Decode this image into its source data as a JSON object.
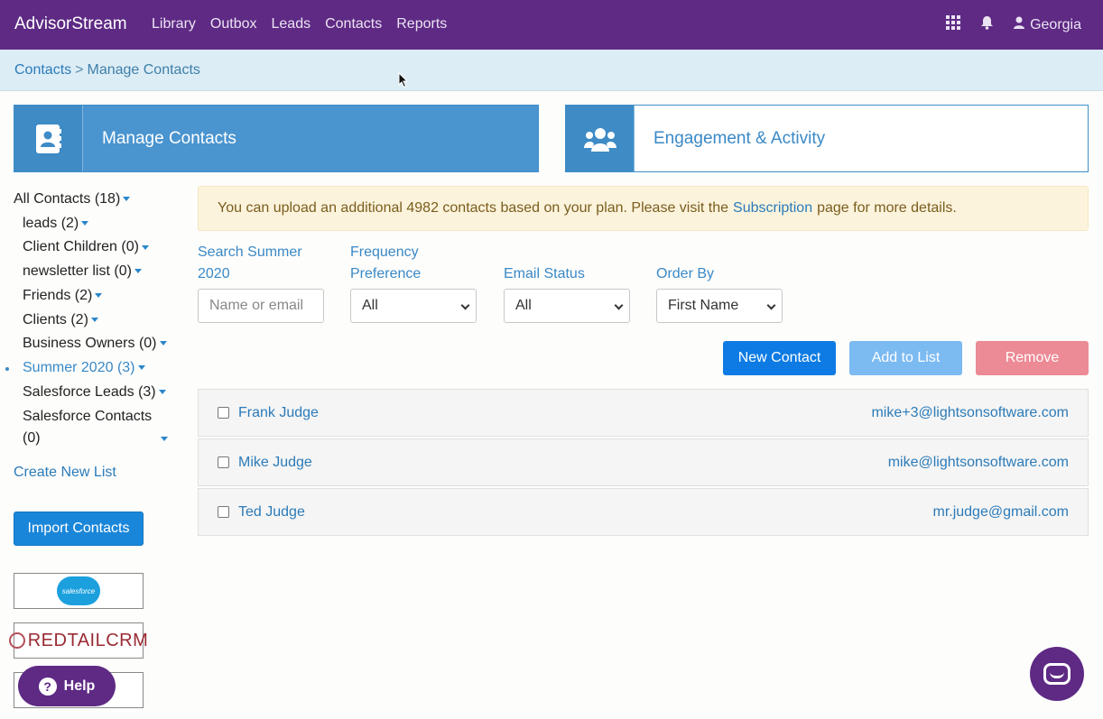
{
  "nav": {
    "brand": "AdvisorStream",
    "links": [
      "Library",
      "Outbox",
      "Leads",
      "Contacts",
      "Reports"
    ],
    "user": "Georgia",
    "icons": [
      "grid-icon",
      "bell-icon",
      "user-icon"
    ]
  },
  "breadcrumb": {
    "root": "Contacts",
    "separator": ">",
    "current": "Manage Contacts"
  },
  "cards": {
    "manage": "Manage Contacts",
    "engage": "Engagement & Activity"
  },
  "sidebar": {
    "all": "All Contacts (18)",
    "lists": [
      {
        "label": "leads (2)"
      },
      {
        "label": "Client Children (0)"
      },
      {
        "label": "newsletter list (0)"
      },
      {
        "label": "Friends (2)"
      },
      {
        "label": "Clients (2)"
      },
      {
        "label": "Business Owners (0)"
      },
      {
        "label": "Summer 2020 (3)",
        "active": true
      },
      {
        "label": "Salesforce Leads (3)"
      },
      {
        "label": "Salesforce Contacts (0)"
      }
    ],
    "create_link": "Create New List",
    "import_button": "Import Contacts",
    "integrations": [
      "salesforce",
      "REDTAILCRM"
    ],
    "help": "Help"
  },
  "alert": {
    "before": "You can upload an additional 4982 contacts based on your plan. Please visit the",
    "link": "Subscription",
    "after": "page for more details."
  },
  "filters": {
    "search_label": "Search Summer 2020",
    "search_placeholder": "Name or email",
    "frequency_label": "Frequency Preference",
    "frequency_value": "All",
    "email_label": "Email Status",
    "email_value": "All",
    "order_label": "Order By",
    "order_value": "First Name"
  },
  "actions": {
    "new": "New Contact",
    "add": "Add to List",
    "remove": "Remove"
  },
  "contacts": [
    {
      "name": "Frank Judge",
      "email": "mike+3@lightsonsoftware.com"
    },
    {
      "name": "Mike Judge",
      "email": "mike@lightsonsoftware.com"
    },
    {
      "name": "Ted Judge",
      "email": "mr.judge@gmail.com"
    }
  ],
  "colors": {
    "nav": "#5e2a84",
    "accent": "#3a89c6",
    "new_button": "#0d7be3",
    "remove_button": "#ec8a95"
  }
}
